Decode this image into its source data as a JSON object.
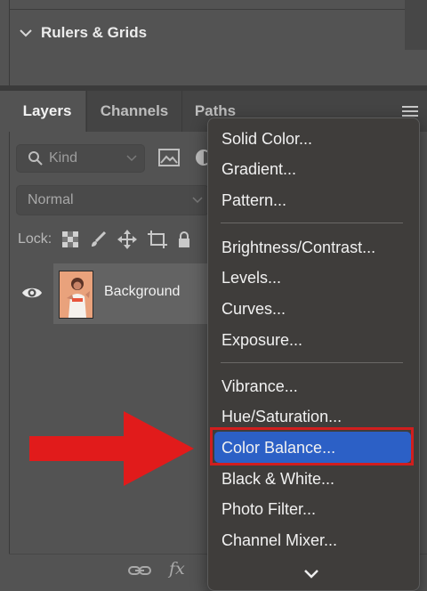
{
  "top_panel": {
    "section_title": "Rulers & Grids"
  },
  "tabs": [
    {
      "label": "Layers",
      "active": true
    },
    {
      "label": "Channels",
      "active": false
    },
    {
      "label": "Paths",
      "active": false
    }
  ],
  "filter": {
    "kind_label": "Kind"
  },
  "blend_mode": {
    "value": "Normal"
  },
  "lock": {
    "label": "Lock:"
  },
  "layers": [
    {
      "name": "Background",
      "visible": true
    }
  ],
  "bottom_bar": {
    "fx_label": "fx"
  },
  "menu": {
    "groups": [
      [
        "Solid Color...",
        "Gradient...",
        "Pattern..."
      ],
      [
        "Brightness/Contrast...",
        "Levels...",
        "Curves...",
        "Exposure..."
      ],
      [
        "Vibrance...",
        "Hue/Saturation...",
        "Color Balance...",
        "Black & White...",
        "Photo Filter...",
        "Channel Mixer..."
      ]
    ],
    "highlighted_item": "Color Balance..."
  },
  "colors": {
    "panel_bg": "#535353",
    "menu_bg": "#3f3d3b",
    "highlight": "#2c60c6",
    "annotation_red": "#e11b1b"
  }
}
